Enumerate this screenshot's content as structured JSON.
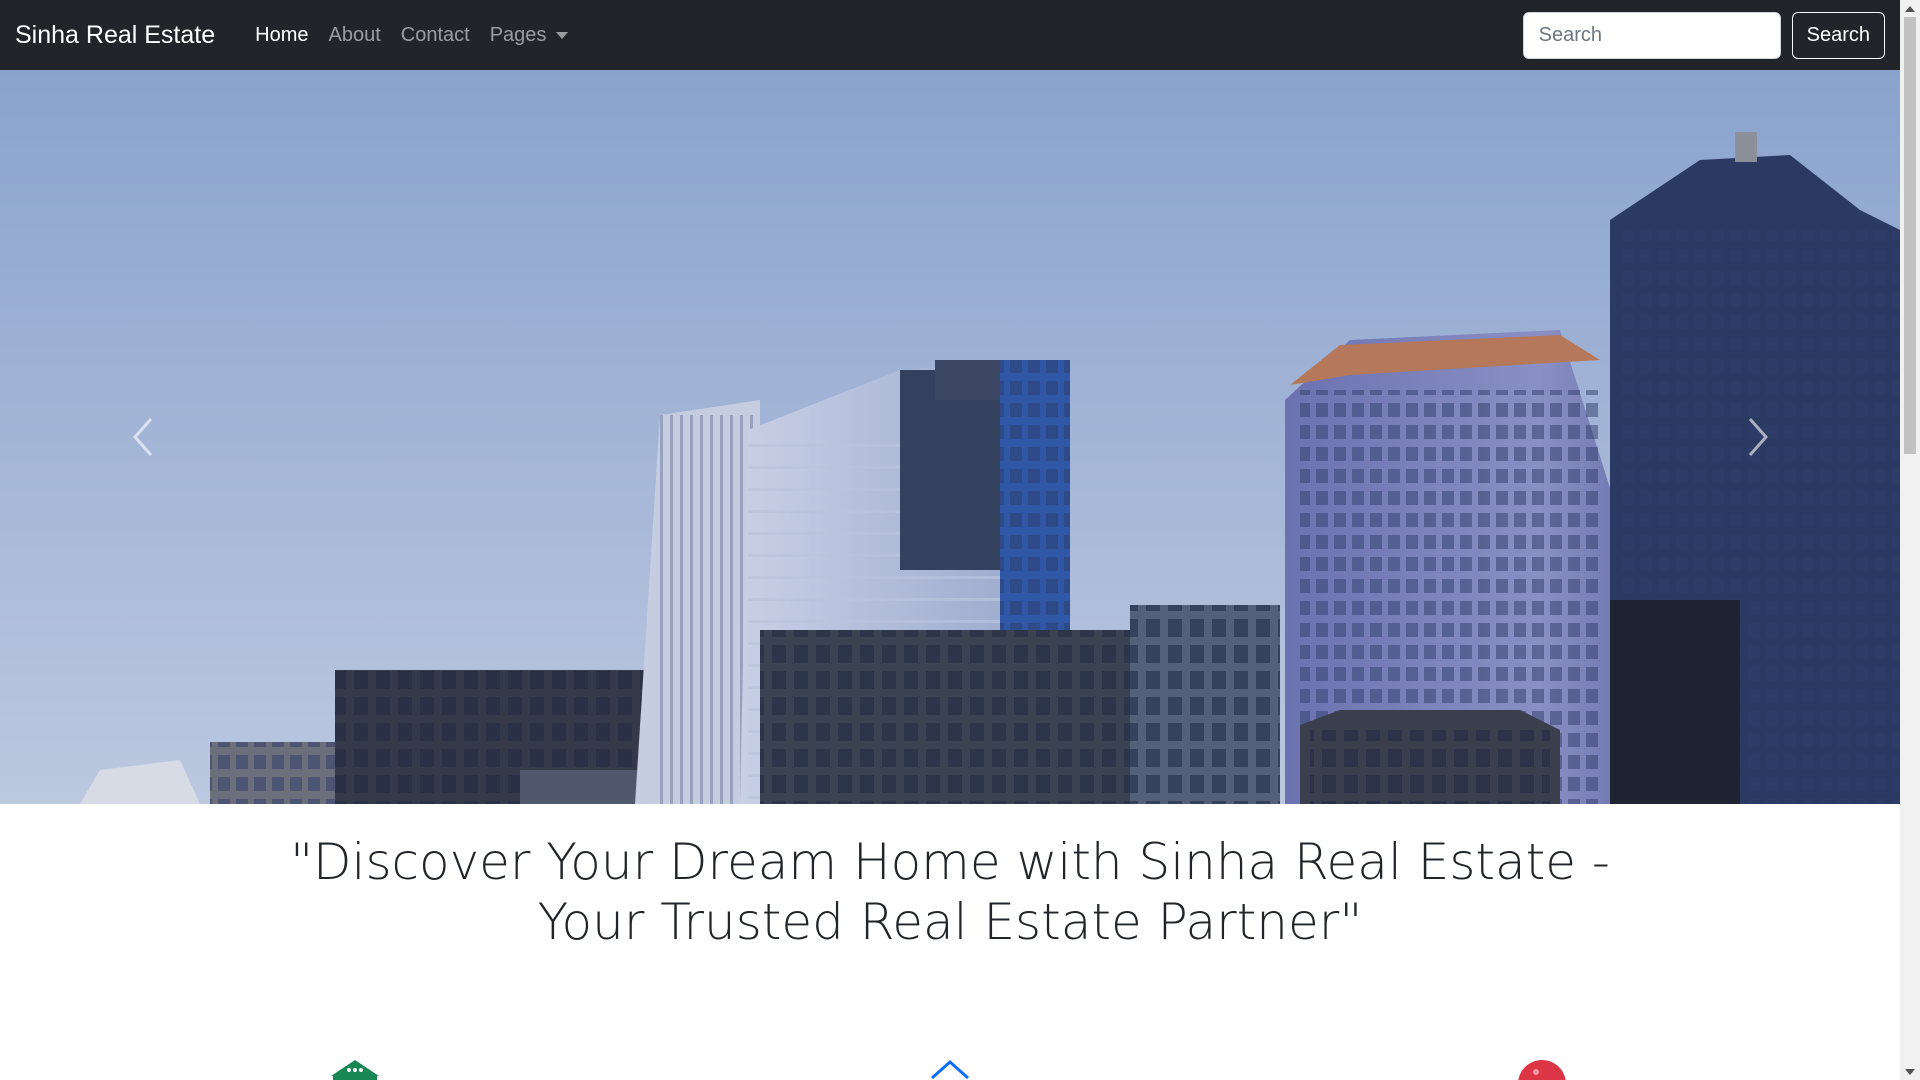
{
  "navbar": {
    "brand": "Sinha Real Estate",
    "links": [
      {
        "label": "Home",
        "active": true
      },
      {
        "label": "About",
        "active": false
      },
      {
        "label": "Contact",
        "active": false
      },
      {
        "label": "Pages",
        "active": false,
        "dropdown": true
      }
    ],
    "search": {
      "placeholder": "Search",
      "value": "",
      "button_label": "Search"
    }
  },
  "carousel": {
    "image": "city-skyscrapers-photo",
    "prev_icon": "chevron-left-icon",
    "next_icon": "chevron-right-icon"
  },
  "main": {
    "tagline_line1": "\"Discover Your Dream Home with Sinha Real Estate -",
    "tagline_line2": "Your Trusted Real Estate Partner\""
  },
  "features": [
    {
      "icon": "building-icon",
      "color": "#198754"
    },
    {
      "icon": "house-icon",
      "color": "#0d6efd"
    },
    {
      "icon": "location-pin-icon",
      "color": "#dc3545"
    }
  ],
  "colors": {
    "navbar_bg": "#212529",
    "accent_green": "#198754",
    "accent_blue": "#0d6efd",
    "accent_red": "#dc3545"
  }
}
